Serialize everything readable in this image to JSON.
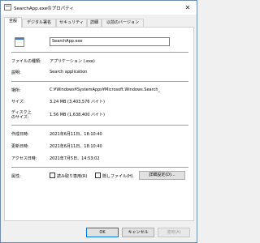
{
  "window": {
    "title": "SearchApp.exeのプロパティ",
    "close_glyph": "✕"
  },
  "tabs": [
    {
      "label": "全般"
    },
    {
      "label": "デジタル署名"
    },
    {
      "label": "セキュリティ"
    },
    {
      "label": "詳細"
    },
    {
      "label": "以前のバージョン"
    }
  ],
  "general": {
    "file_name": "SearchApp.exe",
    "type_label": "ファイルの種類:",
    "type_value": "アプリケーション (.exe)",
    "desc_label": "説明:",
    "desc_value": "Search application",
    "location_label": "場所:",
    "location_value": "C:¥Windows¥SystemApps¥Microsoft.Windows.Search_",
    "size_label": "サイズ:",
    "size_value": "3.24 MB (3,403,576 バイト)",
    "disk_label_1": "ディスク上",
    "disk_label_2": "のサイズ:",
    "disk_value": "1.56 MB (1,638,400 バイト)",
    "created_label": "作成日時:",
    "created_value": "2021年6月11日、18:10:40",
    "modified_label": "更新日時:",
    "modified_value": "2021年6月11日、18:10:40",
    "accessed_label": "アクセス日時:",
    "accessed_value": "2021年7月5日、14:53:02",
    "attr_label": "属性:",
    "readonly_label": "読み取り専用(R)",
    "hidden_label": "隠しファイル(H)",
    "advanced_label": "詳細設定(D)..."
  },
  "buttons": {
    "ok": "OK",
    "cancel": "キャンセル",
    "apply": "適用(A)"
  }
}
